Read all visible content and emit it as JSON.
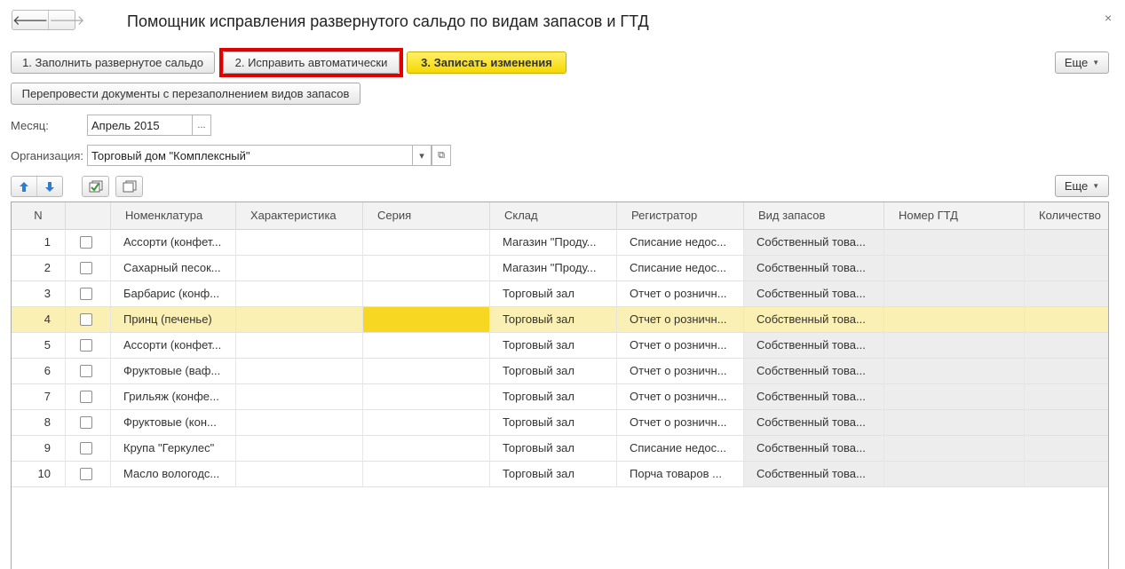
{
  "window": {
    "title": "Помощник исправления развернутого сальдо по видам запасов и ГТД",
    "close_glyph": "×",
    "back_glyph": "🡐",
    "forward_glyph": "🡒"
  },
  "toolbar": {
    "fill_label": "1. Заполнить развернутое сальдо",
    "auto_fix_label": "2. Исправить автоматически",
    "write_label": "3. Записать изменения",
    "more_label": "Еще",
    "repost_label": "Перепровести документы с перезаполнением видов запасов"
  },
  "form": {
    "month_label": "Месяц:",
    "month_value": "Апрель 2015",
    "month_select_glyph": "...",
    "org_label": "Организация:",
    "org_value": "Торговый дом \"Комплексный\"",
    "org_dropdown_glyph": "▾",
    "org_open_glyph": "⧉"
  },
  "table_toolbar": {
    "more_label": "Еще"
  },
  "table": {
    "columns": [
      "N",
      "",
      "Номенклатура",
      "Характеристика",
      "Серия",
      "Склад",
      "Регистратор",
      "Вид запасов",
      "Номер ГТД",
      "Количество"
    ],
    "selected_row": 3,
    "rows": [
      {
        "n": "1",
        "item": "Ассорти (конфет...",
        "char": "",
        "series": "",
        "warehouse": "Магазин \"Проду...",
        "registrar": "Списание недос...",
        "stock_type": "Собственный това...",
        "gtd": "",
        "qty": ""
      },
      {
        "n": "2",
        "item": "Сахарный песок...",
        "char": "",
        "series": "",
        "warehouse": "Магазин \"Проду...",
        "registrar": "Списание недос...",
        "stock_type": "Собственный това...",
        "gtd": "",
        "qty": ""
      },
      {
        "n": "3",
        "item": "Барбарис (конф...",
        "char": "",
        "series": "",
        "warehouse": "Торговый зал",
        "registrar": "Отчет о розничн...",
        "stock_type": "Собственный това...",
        "gtd": "",
        "qty": ""
      },
      {
        "n": "4",
        "item": "Принц (печенье)",
        "char": "",
        "series": "",
        "warehouse": "Торговый зал",
        "registrar": "Отчет о розничн...",
        "stock_type": "Собственный това...",
        "gtd": "",
        "qty": ""
      },
      {
        "n": "5",
        "item": "Ассорти (конфет...",
        "char": "",
        "series": "",
        "warehouse": "Торговый зал",
        "registrar": "Отчет о розничн...",
        "stock_type": "Собственный това...",
        "gtd": "",
        "qty": ""
      },
      {
        "n": "6",
        "item": "Фруктовые (ваф...",
        "char": "",
        "series": "",
        "warehouse": "Торговый зал",
        "registrar": "Отчет о розничн...",
        "stock_type": "Собственный това...",
        "gtd": "",
        "qty": ""
      },
      {
        "n": "7",
        "item": "Грильяж (конфе...",
        "char": "",
        "series": "",
        "warehouse": "Торговый зал",
        "registrar": "Отчет о розничн...",
        "stock_type": "Собственный това...",
        "gtd": "",
        "qty": ""
      },
      {
        "n": "8",
        "item": "Фруктовые (кон...",
        "char": "",
        "series": "",
        "warehouse": "Торговый зал",
        "registrar": "Отчет о розничн...",
        "stock_type": "Собственный това...",
        "gtd": "",
        "qty": ""
      },
      {
        "n": "9",
        "item": "Крупа \"Геркулес\"",
        "char": "",
        "series": "",
        "warehouse": "Торговый зал",
        "registrar": "Списание недос...",
        "stock_type": "Собственный това...",
        "gtd": "",
        "qty": ""
      },
      {
        "n": "10",
        "item": "Масло вологодс...",
        "char": "",
        "series": "",
        "warehouse": "Торговый зал",
        "registrar": "Порча товаров ...",
        "stock_type": "Собственный това...",
        "gtd": "",
        "qty": ""
      }
    ]
  },
  "colors": {
    "accent_yellow": "#f5d800",
    "highlight_red": "#e00000",
    "selected_row": "#fbf0b3",
    "current_cell": "#f8d723",
    "arrow_blue": "#2a7fd4"
  }
}
